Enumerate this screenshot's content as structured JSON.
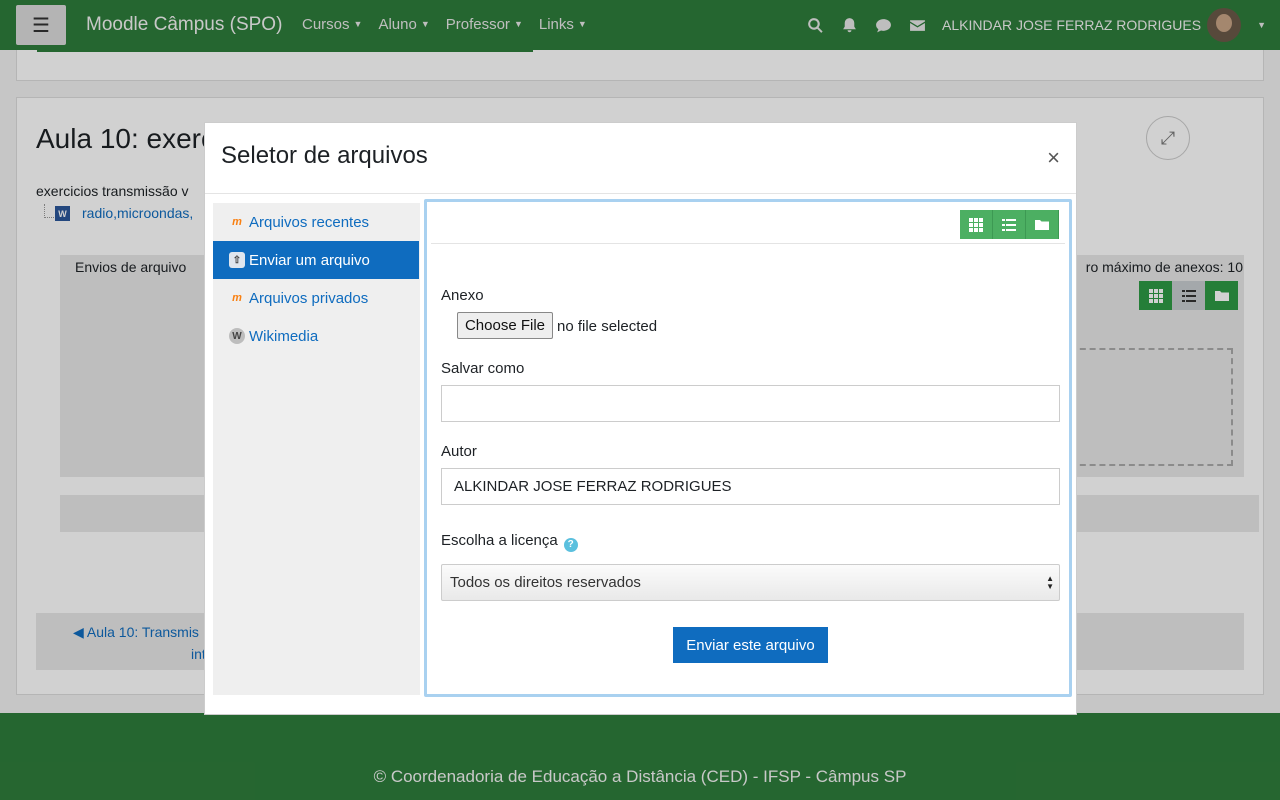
{
  "navbar": {
    "site_name": "Moodle Câmpus (SPO)",
    "menu_icon": "hamburger-icon",
    "menus": [
      "Cursos",
      "Aluno",
      "Professor",
      "Links"
    ],
    "icons": [
      "search-icon",
      "bell-icon",
      "chat-icon",
      "envelope-icon"
    ],
    "user_name": "ALKINDAR JOSE FERRAZ RODRIGUES"
  },
  "page": {
    "title": "Aula 10: exerc",
    "description": "exercicios transmissão v",
    "file_link": "radio,microondas,",
    "file_icon_letter": "W",
    "submissions_label": "Envios de arquivo",
    "max_attachments": "ro máximo de anexos: 10",
    "prev_nav_line1": "◀ Aula 10: Transmis",
    "prev_nav_line2": "int"
  },
  "modal": {
    "title": "Seletor de arquivos",
    "close_glyph": "×",
    "repositories": [
      {
        "label": "Arquivos recentes",
        "icon": "moodle-icon",
        "active": false
      },
      {
        "label": "Enviar um arquivo",
        "icon": "upload-icon",
        "active": true
      },
      {
        "label": "Arquivos privados",
        "icon": "moodle-icon",
        "active": false
      },
      {
        "label": "Wikimedia",
        "icon": "wikimedia-icon",
        "active": false
      }
    ],
    "view_buttons": [
      "grid-view-icon",
      "list-view-icon",
      "folder-view-icon"
    ],
    "form": {
      "attachment_label": "Anexo",
      "choose_file_label": "Choose File",
      "no_file_text": "no file selected",
      "save_as_label": "Salvar como",
      "save_as_value": "",
      "author_label": "Autor",
      "author_value": "ALKINDAR JOSE FERRAZ RODRIGUES",
      "license_label": "Escolha a licença",
      "license_selected": "Todos os direitos reservados",
      "submit_label": "Enviar este arquivo"
    }
  },
  "footer": {
    "text": "© Coordenadoria de Educação a Distância (CED) - IFSP - Câmpus SP"
  },
  "colors": {
    "brand_green": "#2e7d3b",
    "primary_blue": "#0f6cbf",
    "view_button_green": "#4caf62"
  }
}
